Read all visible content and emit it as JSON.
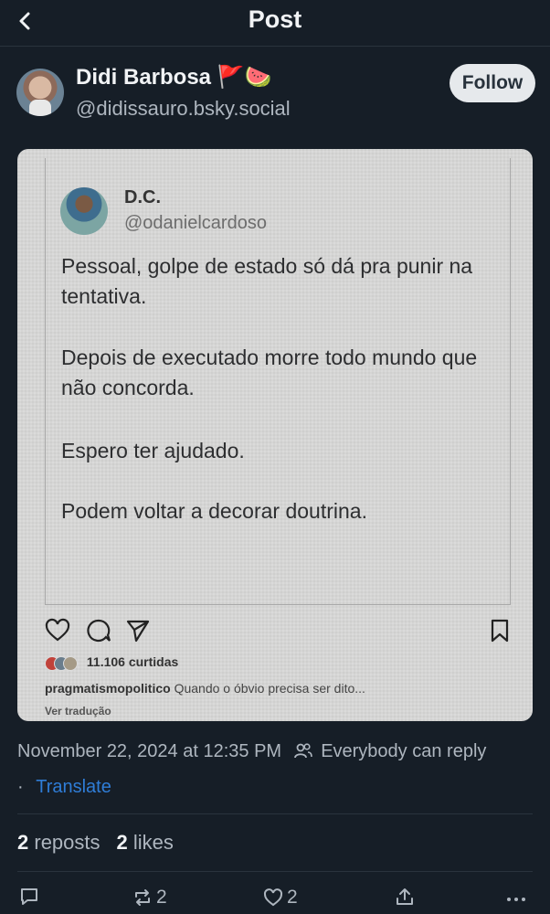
{
  "header": {
    "title": "Post",
    "back_icon": "chevron-left-icon"
  },
  "author": {
    "display_name": "Didi Barbosa",
    "emojis": "🚩🍉",
    "handle": "@didissauro.bsky.social",
    "follow_label": "Follow"
  },
  "embedded_screenshot": {
    "tweet_author_name": "D.C.",
    "tweet_author_handle": "@odanielcardoso",
    "tweet_paragraphs": [
      "Pessoal, golpe de estado só dá pra punir na tentativa.",
      "Depois de executado morre todo mundo que não concorda.",
      "Espero ter ajudado.",
      "Podem voltar a decorar doutrina."
    ],
    "likes_text": "11.106 curtidas",
    "caption_user": "pragmatismopolitico",
    "caption_text": "Quando o óbvio precisa ser dito...",
    "translation_link": "Ver tradução"
  },
  "meta": {
    "timestamp": "November 22, 2024 at 12:35 PM",
    "reply_setting": "Everybody can reply",
    "separator": "·",
    "translate_label": "Translate"
  },
  "stats": {
    "reposts_count": "2",
    "reposts_label": "reposts",
    "likes_count": "2",
    "likes_label": "likes"
  },
  "actions": {
    "repost_count": "2",
    "like_count": "2"
  },
  "colors": {
    "background": "#161e27",
    "accent_link": "#2f7dd7",
    "follow_button_bg": "#e6e9ec"
  }
}
